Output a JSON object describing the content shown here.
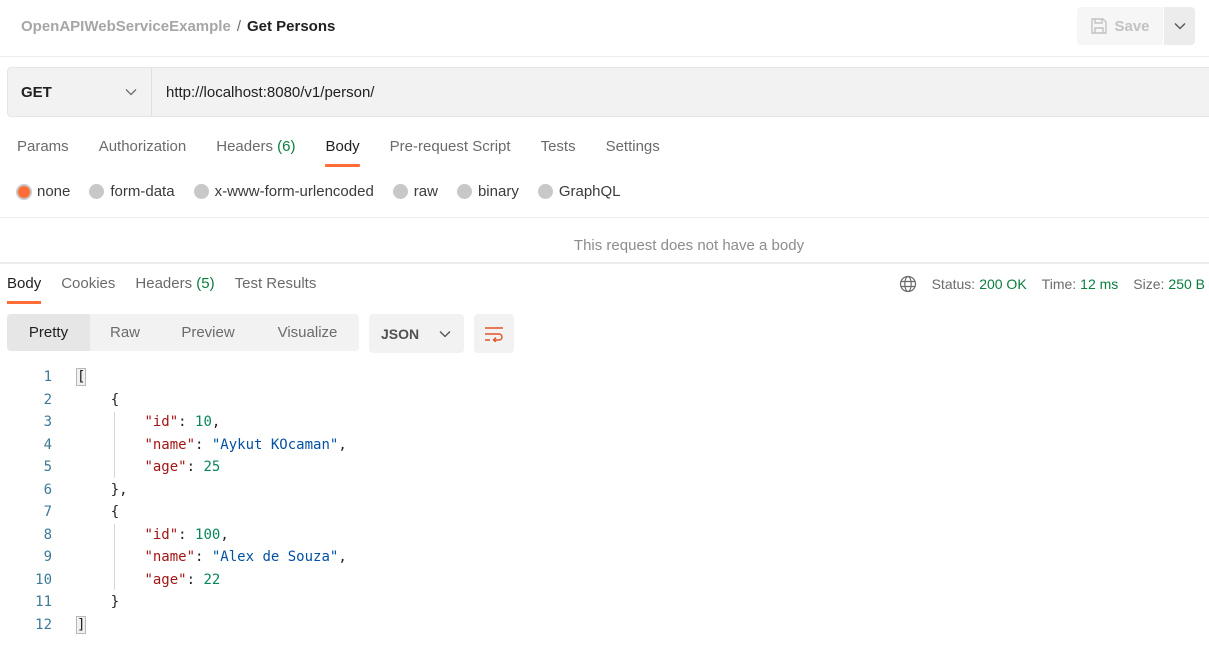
{
  "header": {
    "collection": "OpenAPIWebServiceExample",
    "separator": "/",
    "request_name": "Get Persons",
    "save_label": "Save"
  },
  "request": {
    "method": "GET",
    "url": "http://localhost:8080/v1/person/"
  },
  "request_tabs": [
    {
      "label": "Params",
      "count": ""
    },
    {
      "label": "Authorization",
      "count": ""
    },
    {
      "label": "Headers",
      "count": "(6)"
    },
    {
      "label": "Body",
      "count": "",
      "active": true
    },
    {
      "label": "Pre-request Script",
      "count": ""
    },
    {
      "label": "Tests",
      "count": ""
    },
    {
      "label": "Settings",
      "count": ""
    }
  ],
  "body_types": [
    {
      "label": "none",
      "selected": true
    },
    {
      "label": "form-data"
    },
    {
      "label": "x-www-form-urlencoded"
    },
    {
      "label": "raw"
    },
    {
      "label": "binary"
    },
    {
      "label": "GraphQL"
    }
  ],
  "no_body_message": "This request does not have a body",
  "response_tabs": [
    {
      "label": "Body",
      "count": "",
      "active": true
    },
    {
      "label": "Cookies",
      "count": ""
    },
    {
      "label": "Headers",
      "count": "(5)"
    },
    {
      "label": "Test Results",
      "count": ""
    }
  ],
  "response_status": {
    "status_label": "Status:",
    "status_value": "200 OK",
    "time_label": "Time:",
    "time_value": "12 ms",
    "size_label": "Size:",
    "size_value": "250 B"
  },
  "view_tabs": [
    "Pretty",
    "Raw",
    "Preview",
    "Visualize"
  ],
  "format": "JSON",
  "code_lines": [
    "1",
    "2",
    "3",
    "4",
    "5",
    "6",
    "7",
    "8",
    "9",
    "10",
    "11",
    "12"
  ],
  "response_body": [
    {
      "id_key": "\"id\"",
      "id": "10",
      "name_key": "\"name\"",
      "name": "\"Aykut KOcaman\"",
      "age_key": "\"age\"",
      "age": "25"
    },
    {
      "id_key": "\"id\"",
      "id": "100",
      "name_key": "\"name\"",
      "name": "\"Alex de Souza\"",
      "age_key": "\"age\"",
      "age": "22"
    }
  ],
  "punct": {
    "open_arr": "[",
    "close_arr": "]",
    "open_obj": "{",
    "close_obj": "}",
    "close_obj_comma": "},",
    "colon": ": ",
    "comma": ","
  }
}
